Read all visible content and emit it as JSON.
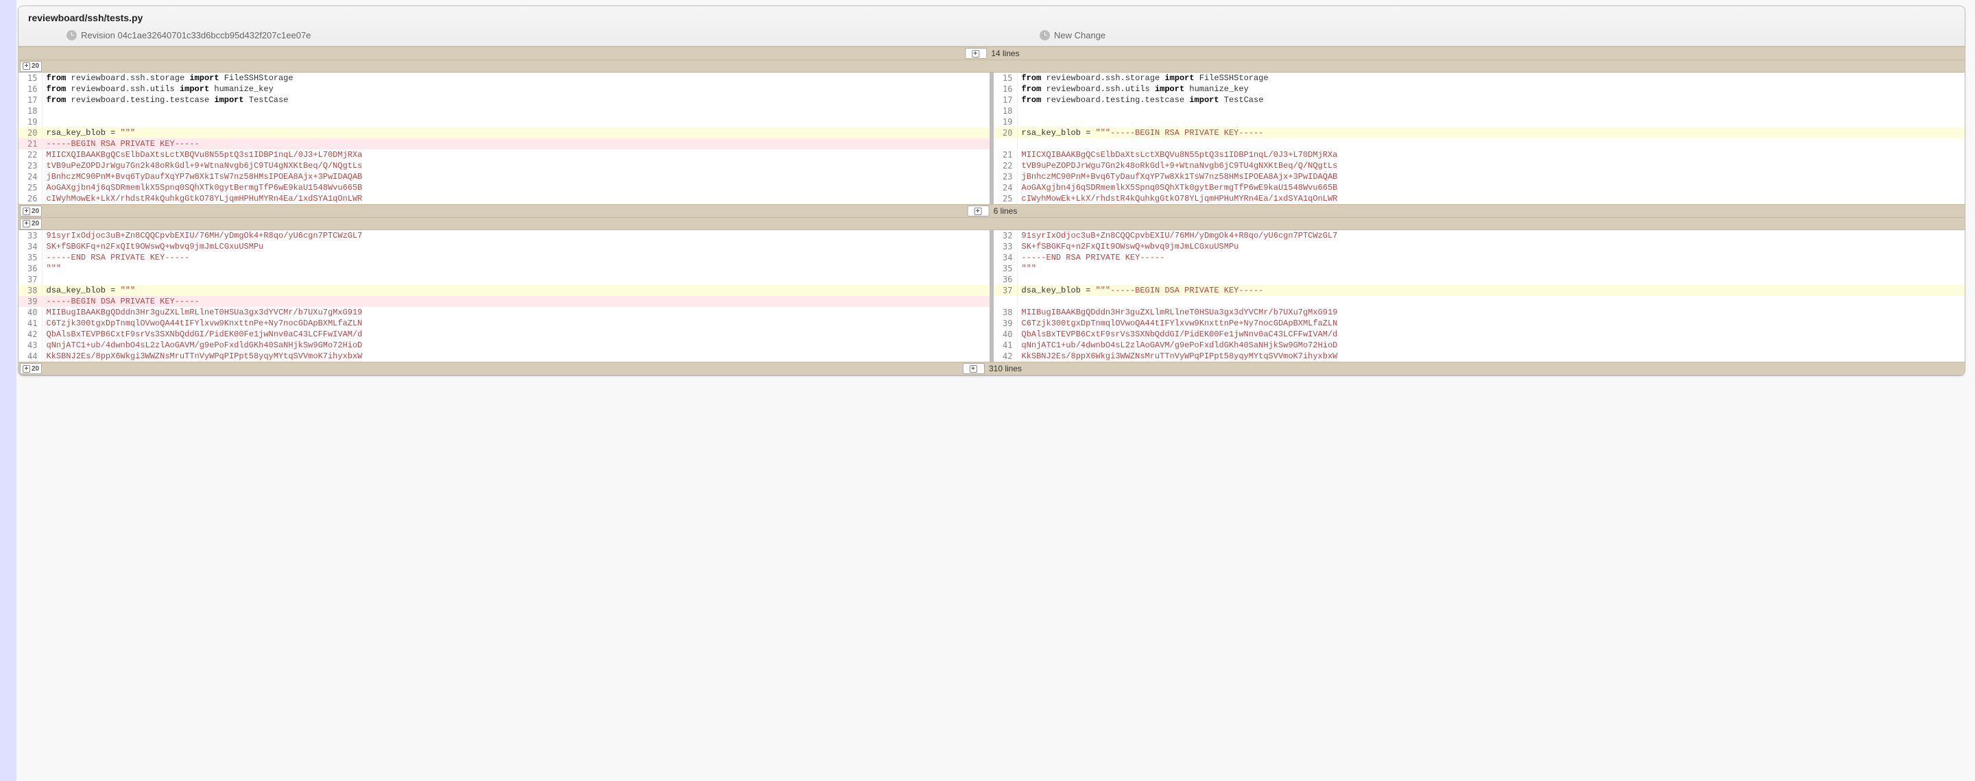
{
  "file": {
    "path": "reviewboard/ssh/tests.py"
  },
  "revisions": {
    "left": {
      "label": "Revision 04c1ae32640701c33d6bccb95d432f207c1ee07e"
    },
    "right": {
      "label": "New Change"
    }
  },
  "expand": {
    "btn20": "20",
    "lines14": "14 lines",
    "lines6": "6 lines",
    "lines310": "310 lines"
  },
  "lines": {
    "l15a": "from",
    "l15b": " reviewboard.ssh.storage ",
    "l15c": "import",
    "l15d": " FileSSHStorage",
    "l16a": "from",
    "l16b": " reviewboard.ssh.utils ",
    "l16c": "import",
    "l16d": " humanize_key",
    "l17a": "from",
    "l17b": " reviewboard.testing.testcase ",
    "l17c": "import",
    "l17d": " TestCase",
    "l20L": "rsa_key_blob = ",
    "l20Lq": "\"\"\"",
    "l20R": "rsa_key_blob = ",
    "l20Rq": "\"\"\"-----BEGIN RSA PRIVATE KEY-----",
    "l21L": "-----BEGIN RSA PRIVATE KEY-----",
    "k22": "MIICXQIBAAKBgQCsElbDaXtsLctXBQVu8N55ptQ3s1IDBP1nqL/0J3+L70DMjRXa",
    "k23": "tVB9uPeZOPDJrWgu7Gn2k48oRkGdl+9+WtnaNvgb6jC9TU4gNXKtBeq/Q/NQgtLs",
    "k24": "jBnhczMC90PnM+Bvq6TyDaufXqYP7w8Xk1TsW7nz58HMsIPOEA8Ajx+3PwIDAQAB",
    "k25": "AoGAXgjbn4j6qSDRmemlkX5Spnq0SQhXTk0gytBermgTfP6wE9kaU1548Wvu665B",
    "k26": "cIWyhMowEk+LkX/rhdstR4kQuhkgGtkO78YLjqmHPHuMYRn4Ea/1xdSYA1qOnLWR",
    "k33": "91syrIxOdjoc3uB+Zn8CQQCpvbEXIU/76MH/yDmgOk4+R8qo/yU6cgn7PTCWzGL7",
    "k34": "SK+fSBGKFq+n2FxQIt9OWswQ+wbvq9jmJmLCGxuUSMPu",
    "k35": "-----END RSA PRIVATE KEY-----",
    "k36": "\"\"\"",
    "l38L": "dsa_key_blob = ",
    "l38Lq": "\"\"\"",
    "l37R": "dsa_key_blob = ",
    "l37Rq": "\"\"\"-----BEGIN DSA PRIVATE KEY-----",
    "l39L": "-----BEGIN DSA PRIVATE KEY-----",
    "d40": "MIIBugIBAAKBgQDddn3Hr3guZXLlmRLlneT0HSUa3gx3dYVCMr/b7UXu7gMxG919",
    "d41": "C6Tzjk300tgxDpTnmqlOVwoQA44tIFYlxvw9KnxttnPe+Ny7nocGDApBXMLfaZLN",
    "d42": "QbAlsBxTEVPB6CxtF9srVs3SXNbQddGI/PidEK00Fe1jwNnv0aC43LCFFwIVAM/d",
    "d43": "qNnjATC1+ub/4dwnbO4sL2zlAoGAVM/g9ePoFxdldGKh40SaNHjkSw9GMo72HioD",
    "d44": "KkSBNJ2Es/8ppX6Wkgi3WWZNsMruTTnVyWPqPIPpt58yqyMYtqSVVmoK7ihyxbxW"
  },
  "ln": {
    "L": [
      "15",
      "16",
      "17",
      "18",
      "19",
      "20",
      "21",
      "22",
      "23",
      "24",
      "25",
      "26",
      "33",
      "34",
      "35",
      "36",
      "37",
      "38",
      "39",
      "40",
      "41",
      "42",
      "43",
      "44"
    ],
    "R": [
      "15",
      "16",
      "17",
      "18",
      "19",
      "20",
      "",
      "21",
      "22",
      "23",
      "24",
      "25",
      "32",
      "33",
      "34",
      "35",
      "36",
      "37",
      "",
      "38",
      "39",
      "40",
      "41",
      "42"
    ]
  }
}
